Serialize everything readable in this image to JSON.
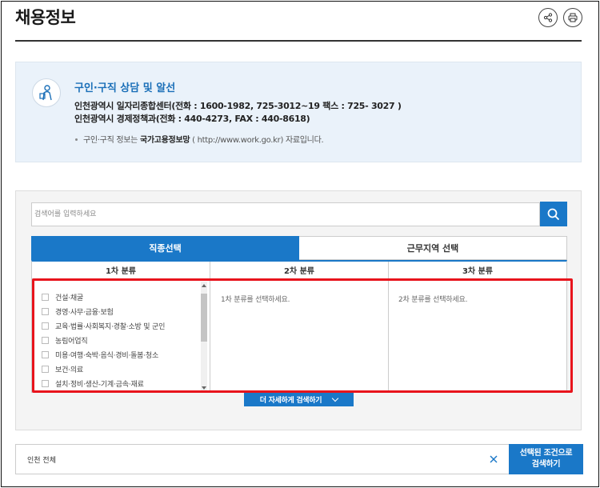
{
  "header": {
    "title": "채용정보",
    "share_icon": "share-icon",
    "print_icon": "printer-icon"
  },
  "info_box": {
    "icon": "person-consult-icon",
    "heading": "구인·구직 상담 및 알선",
    "line1": "인천광역시 일자리종합센터(전화 : 1600-1982, 725-3012~19 팩스 : 725- 3027 )",
    "line2": "인천광역시 경제정책과(전화 : 440-4273, FAX : 440-8618)",
    "note_prefix": "구인·구직 정보는 ",
    "note_source": "국가고용정보망",
    "note_suffix": " ( http://www.work.go.kr) 자료입니다."
  },
  "search": {
    "placeholder": "검색어를 입력하세요",
    "button_icon": "search-icon"
  },
  "tabs": [
    {
      "label": "직종선택",
      "active": true
    },
    {
      "label": "근무지역 선택",
      "active": false
    }
  ],
  "columns": {
    "headers": [
      "1차 분류",
      "2차 분류",
      "3차 분류"
    ],
    "first_level_items": [
      "건설·채굴",
      "경영·사무·금융·보험",
      "교육·법률·사회복지·경찰·소방 및 군인",
      "농림어업직",
      "미용·여행·숙박·음식·경비·돌봄·청소",
      "보건·의료",
      "설치·정비·생산-기계·금속·재료"
    ],
    "second_hint": "1차 분류를 선택하세요.",
    "third_hint": "2차 분류를 선택하세요."
  },
  "detail_search_label": "더 자세하게 검색하기",
  "bottom_bar": {
    "condition": "인천 전체",
    "clear_icon": "close-icon",
    "apply_line1": "선택된 조건으로",
    "apply_line2": "검색하기"
  },
  "colors": {
    "accent": "#1a78c8",
    "highlight": "#e8141c",
    "info_bg": "#eaf2fa"
  }
}
